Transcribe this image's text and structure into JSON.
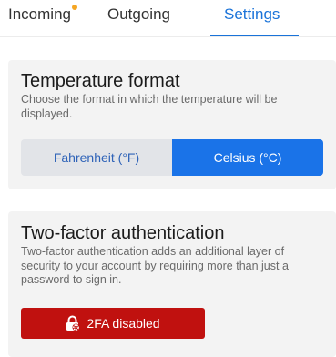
{
  "tabs": {
    "incoming": "Incoming",
    "outgoing": "Outgoing",
    "settings": "Settings",
    "active": "Settings",
    "notification_dot_color": "#f5a623"
  },
  "temperature": {
    "title": "Temperature format",
    "description": "Choose the format in which the temperature will be displayed.",
    "options": [
      "Fahrenheit (°F)",
      "Celsius (°C)"
    ],
    "selected": "Celsius (°C)"
  },
  "two_factor": {
    "title": "Two-factor authentication",
    "description": "Two-factor authentication adds an additional layer of security to your account by requiring more than just a password to sign in.",
    "button_label": "2FA disabled",
    "button_icon": "lock-gear-icon",
    "status_color": "#c0110f"
  },
  "colors": {
    "accent": "#1a73e8",
    "tab_active": "#1a73d9"
  }
}
